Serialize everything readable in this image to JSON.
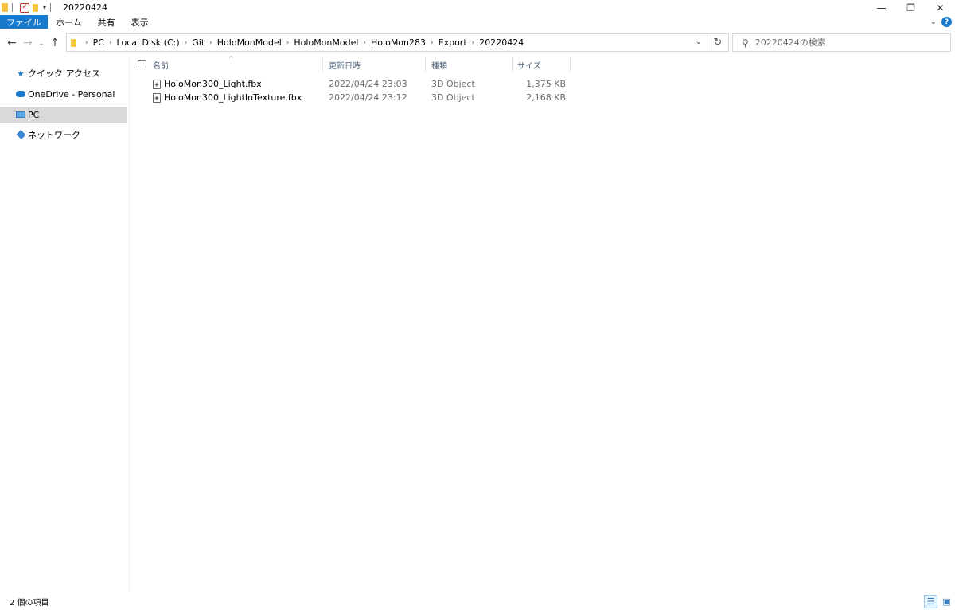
{
  "window": {
    "title": "20220424",
    "minimize_glyph": "—",
    "maximize_glyph": "❐",
    "close_glyph": "✕"
  },
  "ribbon": {
    "tabs": [
      "ファイル",
      "ホーム",
      "共有",
      "表示"
    ],
    "help_glyph": "?"
  },
  "navigation": {
    "back_glyph": "←",
    "forward_glyph": "→",
    "recent_glyph": "⌄",
    "up_glyph": "↑",
    "refresh_glyph": "↻"
  },
  "address": {
    "breadcrumbs": [
      "PC",
      "Local Disk (C:)",
      "Git",
      "HoloMonModel",
      "HoloMonModel",
      "HoloMon283",
      "Export",
      "20220424"
    ],
    "separator": "›"
  },
  "search": {
    "placeholder": "20220424の検索"
  },
  "sidebar": {
    "items": [
      {
        "label": "クイック アクセス",
        "icon": "star-icon"
      },
      {
        "label": "OneDrive - Personal",
        "icon": "cloud-icon"
      },
      {
        "label": "PC",
        "icon": "pc-icon",
        "selected": true
      },
      {
        "label": "ネットワーク",
        "icon": "network-icon"
      }
    ]
  },
  "columns": {
    "name": "名前",
    "modified": "更新日時",
    "type": "種類",
    "size": "サイズ"
  },
  "files": [
    {
      "name": "HoloMon300_Light.fbx",
      "modified": "2022/04/24 23:03",
      "type": "3D Object",
      "size": "1,375 KB"
    },
    {
      "name": "HoloMon300_LightInTexture.fbx",
      "modified": "2022/04/24 23:12",
      "type": "3D Object",
      "size": "2,168 KB"
    }
  ],
  "status": {
    "item_count": "2 個の項目"
  },
  "colors": {
    "accent": "#1979ca",
    "selection": "#d9d9d9",
    "folder": "#f5c542"
  }
}
